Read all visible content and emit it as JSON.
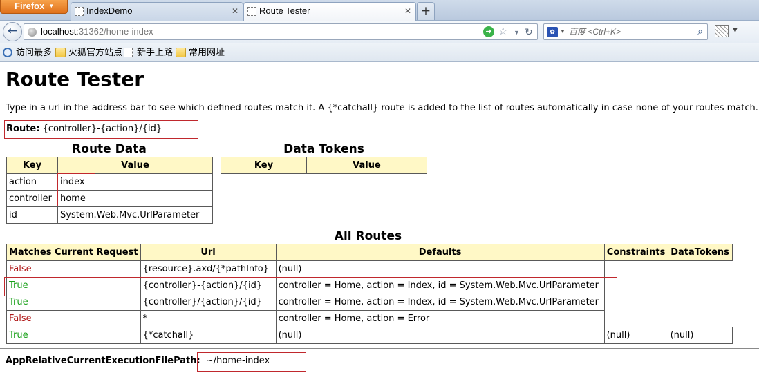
{
  "browser": {
    "menu_label": "Firefox",
    "tabs": [
      {
        "title": "IndexDemo",
        "active": false
      },
      {
        "title": "Route Tester",
        "active": true
      }
    ],
    "new_tab_label": "+",
    "url_host": "localhost",
    "url_rest": ":31362/home-index",
    "search_placeholder": "百度 <Ctrl+K>",
    "bookmarks": [
      "访问最多",
      "火狐官方站点",
      "新手上路",
      "常用网址"
    ]
  },
  "page": {
    "title": "Route Tester",
    "intro": "Type in a url in the address bar to see which defined routes match it. A {*catchall} route is added to the list of routes automatically in case none of your routes match.",
    "route_label": "Route:",
    "route_value": "{controller}-{action}/{id}"
  },
  "route_data": {
    "caption": "Route Data",
    "headers": [
      "Key",
      "Value"
    ],
    "rows": [
      [
        "action",
        "index"
      ],
      [
        "controller",
        "home"
      ],
      [
        "id",
        "System.Web.Mvc.UrlParameter"
      ]
    ]
  },
  "data_tokens": {
    "caption": "Data Tokens",
    "headers": [
      "Key",
      "Value"
    ]
  },
  "all_routes": {
    "caption": "All Routes",
    "headers": [
      "Matches Current Request",
      "Url",
      "Defaults",
      "Constraints",
      "DataTokens"
    ],
    "rows": [
      {
        "match": "False",
        "url": "{resource}.axd/{*pathInfo}",
        "defaults": "(null)",
        "constraints": "",
        "tokens": ""
      },
      {
        "match": "True",
        "url": "{controller}-{action}/{id}",
        "defaults": "controller = Home, action = Index, id = System.Web.Mvc.UrlParameter",
        "constraints": "",
        "tokens": ""
      },
      {
        "match": "True",
        "url": "{controller}/{action}/{id}",
        "defaults": "controller = Home, action = Index, id = System.Web.Mvc.UrlParameter",
        "constraints": "",
        "tokens": ""
      },
      {
        "match": "False",
        "url": "*",
        "defaults": "controller = Home, action = Error",
        "constraints": "",
        "tokens": ""
      },
      {
        "match": "True",
        "url": "{*catchall}",
        "defaults": "(null)",
        "constraints": "(null)",
        "tokens": "(null)"
      }
    ],
    "match_colors": {
      "True": "#18a018",
      "False": "#b01818"
    }
  },
  "exec_path": {
    "label": "AppRelativeCurrentExecutionFilePath:",
    "value": "~/home-index"
  }
}
